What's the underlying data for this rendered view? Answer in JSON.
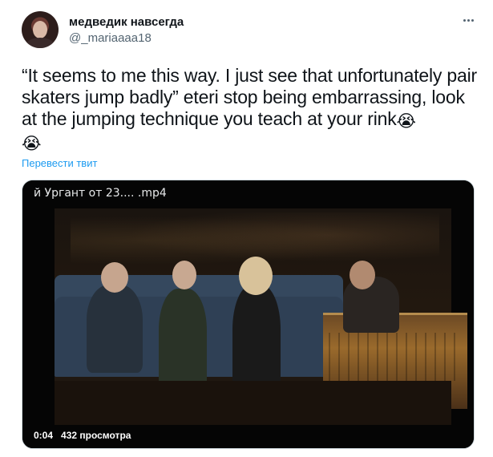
{
  "author": {
    "display_name": "медведик навсегда",
    "handle": "@_mariaaaa18"
  },
  "more_icon": "more-horizontal-icon",
  "tweet": {
    "text": "“It seems to me this way. I just see that unfortunately pair skaters jump badly” eteri stop being embarrassing, look at the jumping technique you teach at your rink",
    "emoji_1": "😭",
    "emoji_2": "😭",
    "translate_label": "Перевести твит"
  },
  "video": {
    "title": "й Ургант от 23....  .mp4",
    "timestamp": "0:04",
    "views": "432 просмотра"
  },
  "colors": {
    "accent": "#1d9bf0",
    "text": "#0f1419",
    "secondary": "#536471"
  }
}
